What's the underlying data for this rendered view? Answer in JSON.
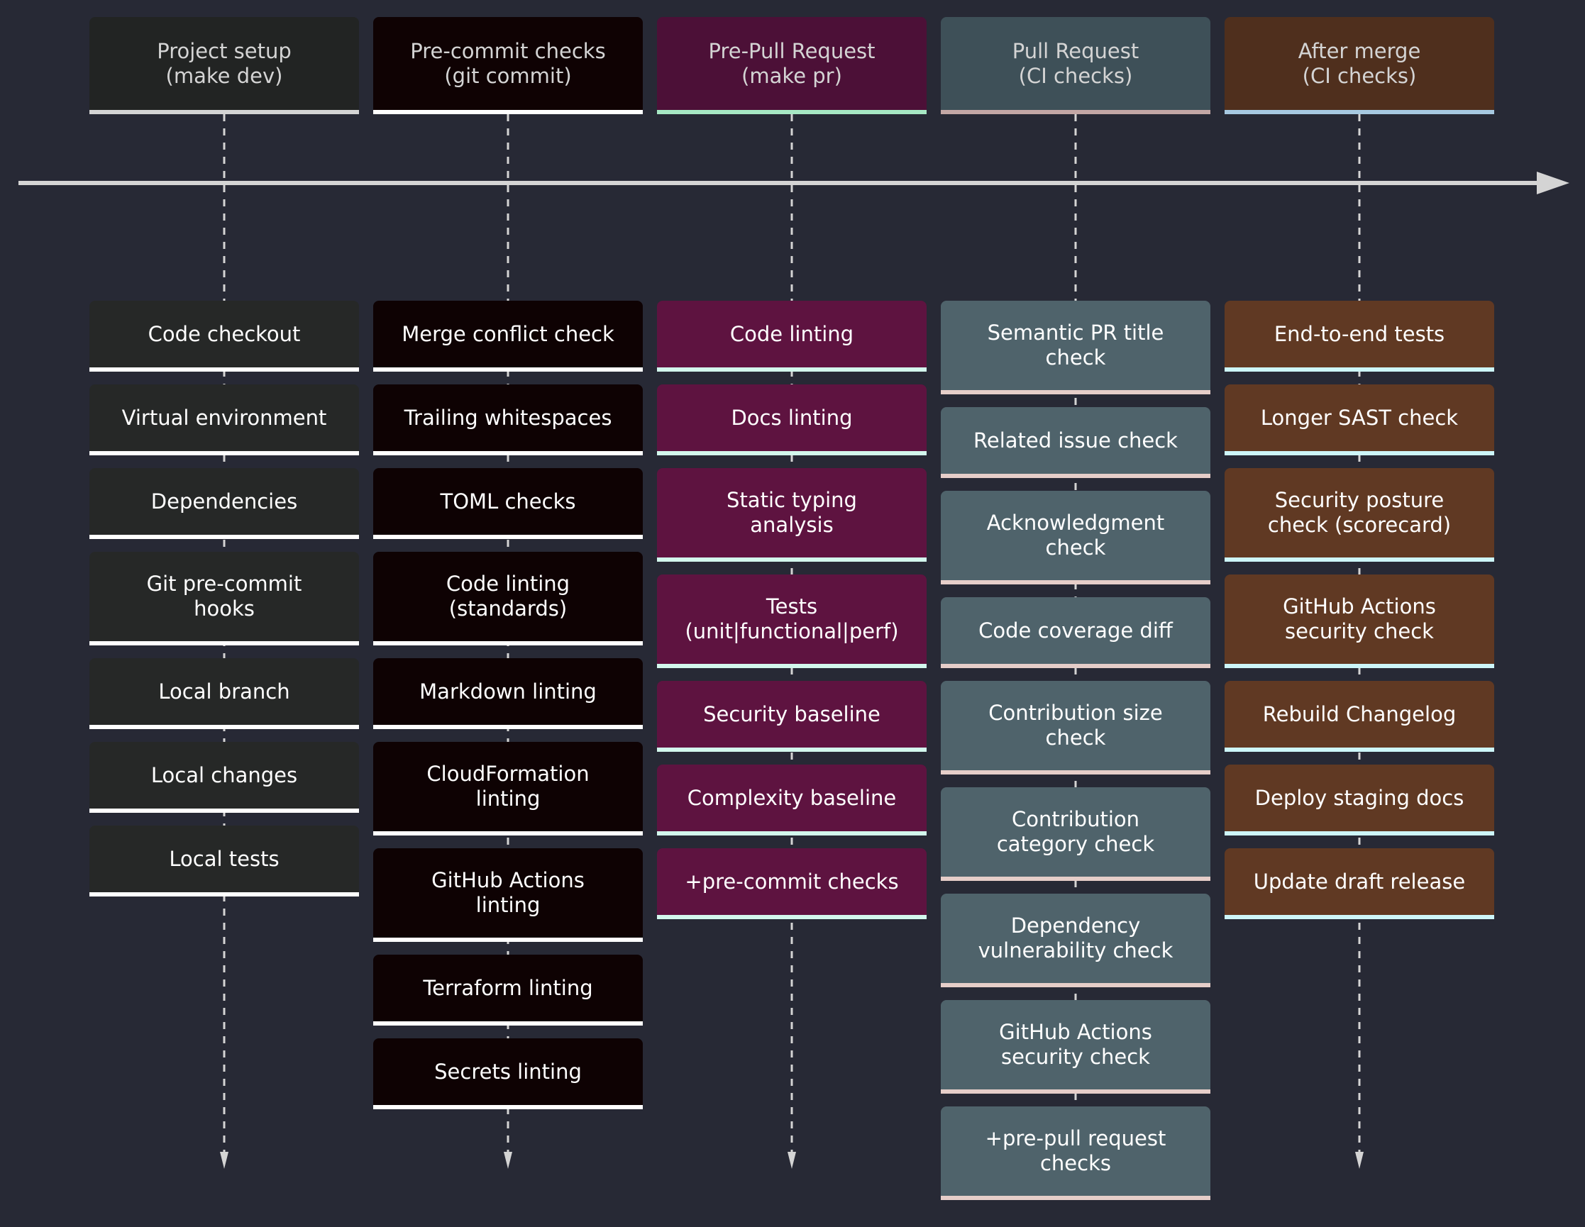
{
  "diagram": {
    "type": "timeline",
    "background": "#272935",
    "sections": [
      {
        "title": "Project setup\n(make dev)",
        "header_color": "#222423",
        "header_line": "#d4d4d4",
        "task_color": "#262827",
        "task_line": "#ffffff",
        "tasks": [
          "Code checkout",
          "Virtual environment",
          "Dependencies",
          "Git pre-commit\nhooks",
          "Local branch",
          "Local changes",
          "Local tests"
        ]
      },
      {
        "title": "Pre-commit checks\n(git commit)",
        "header_color": "#0f0203",
        "header_line": "#ffffff",
        "task_color": "#0e0203",
        "task_line": "#ffffff",
        "tasks": [
          "Merge conflict check",
          "Trailing whitespaces",
          "TOML checks",
          "Code linting\n(standards)",
          "Markdown linting",
          "CloudFormation\nlinting",
          "GitHub Actions\nlinting",
          "Terraform linting",
          "Secrets linting"
        ]
      },
      {
        "title": "Pre-Pull Request\n(make pr)",
        "header_color": "#4c1037",
        "header_line": "#a7e8c4",
        "task_color": "#5e1340",
        "task_line": "#d3f8ed",
        "tasks": [
          "Code linting",
          "Docs linting",
          "Static typing\nanalysis",
          "Tests\n(unit|functional|perf)",
          "Security baseline",
          "Complexity baseline",
          "+pre-commit checks"
        ]
      },
      {
        "title": "Pull Request\n(CI checks)",
        "header_color": "#3e5058",
        "header_line": "#c3a7a5",
        "task_color": "#4f636b",
        "task_line": "#e6cec9",
        "tasks": [
          "Semantic PR title\ncheck",
          "Related issue check",
          "Acknowledgment\ncheck",
          "Code coverage diff",
          "Contribution size\ncheck",
          "Contribution\ncategory check",
          "Dependency\nvulnerability check",
          "GitHub Actions\nsecurity check",
          "+pre-pull request\nchecks"
        ]
      },
      {
        "title": "After merge\n(CI checks)",
        "header_color": "#4f2f1d",
        "header_line": "#a7c9e1",
        "task_color": "#603923",
        "task_line": "#cdf6f9",
        "tasks": [
          "End-to-end tests",
          "Longer SAST check",
          "Security posture\ncheck (scorecard)",
          "GitHub Actions\nsecurity check",
          "Rebuild Changelog",
          "Deploy staging docs",
          "Update draft release"
        ]
      }
    ],
    "timeline_color": "#d4d4d4",
    "connector_color": "#d4d4d4"
  }
}
